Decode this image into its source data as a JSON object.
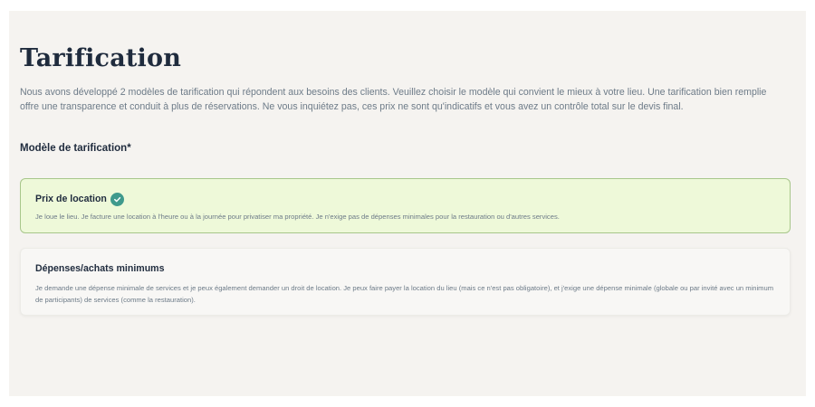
{
  "page": {
    "title": "Tarification",
    "intro": "Nous avons développé 2 modèles de tarification qui répondent aux besoins des clients. Veuillez choisir le modèle qui convient le mieux à votre lieu. Une tarification bien remplie offre une transparence et conduit à plus de réservations. Ne vous inquiétez pas, ces prix ne sont qu'indicatifs et vous avez un contrôle total sur le devis final."
  },
  "pricing_model": {
    "label": "Modèle de tarification*",
    "options": [
      {
        "title": "Prix de location",
        "description": "Je loue le lieu. Je facture une location à l'heure ou à la journée pour privatiser ma propriété. Je n'exige pas de dépenses minimales pour la restauration ou d'autres services.",
        "selected": true,
        "icon": "check-circle-icon"
      },
      {
        "title": "Dépenses/achats minimums",
        "description": "Je demande une dépense minimale de services et je peux également demander un droit de location. Je peux faire payer la location du lieu (mais ce n'est pas obligatoire), et j'exige une dépense minimale (globale ou par invité avec un minimum de participants) de services (comme la restauration).",
        "selected": false
      }
    ]
  },
  "colors": {
    "accent": "#3f9a8c",
    "selected_background": "#eef9d9",
    "selected_border": "#a7c68a",
    "heading": "#1f2b3d",
    "body_text": "#6d7b88",
    "panel_background": "#f5f3f0"
  }
}
